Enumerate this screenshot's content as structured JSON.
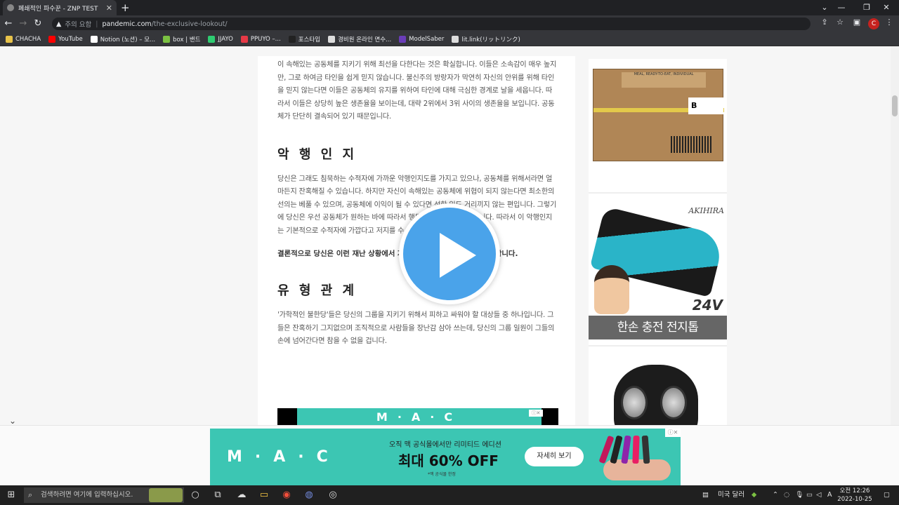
{
  "browser": {
    "tab_title": "폐쇄적인 파수꾼 - ZNP TEST",
    "new_tab": "+",
    "url_warning": "주의 요함",
    "url_host": "pandemic.com",
    "url_path": "/the-exclusive-lookout/",
    "bookmarks": [
      {
        "label": "CHACHA",
        "color": "#e8c34a"
      },
      {
        "label": "YouTube",
        "color": "#ff0000"
      },
      {
        "label": "Notion (노션) – 모...",
        "color": "#ffffff"
      },
      {
        "label": "box | 밴드",
        "color": "#7bc142"
      },
      {
        "label": "JJAYO",
        "color": "#2ecc71"
      },
      {
        "label": "PPUYO –...",
        "color": "#e63946"
      },
      {
        "label": "포스타입",
        "color": "#222222"
      },
      {
        "label": "경비원 온라인 면수...",
        "color": "#dddddd"
      },
      {
        "label": "ModelSaber",
        "color": "#6a3db8"
      },
      {
        "label": "lit.link(リットリンク)",
        "color": "#dddddd"
      }
    ]
  },
  "article": {
    "para1": "이 속해있는 공동체를 지키기 위해 최선을 다한다는 것은 확실합니다. 이들은 소속감이 매우 높지만, 그로 하여금 타인을 쉽게 믿지 않습니다. 불신주의 방랑자가 막연히 자신의 안위를 위해 타인을 믿지 않는다면 이들은 공동체의 유지를 위하여 타인에 대해 극심한 경계로 날을 세웁니다. 따라서 이들은 상당히 높은 생존율을 보이는데, 대략 2위에서 3위 사이의 생존율을 보입니다. 공동체가 단단히 결속되어 있기 때문입니다.",
    "heading1": "악 행 인 지",
    "para2": "당신은 그래도 침묵하는 수적자에 가까운 악행인지도를 가지고 있으나, 공동체를 위해서라면 얼마든지 잔혹해질 수 있습니다. 하지만 자신이 속해있는 공동체에 위협이 되지 않는다면 최소한의 선의는 베풀 수 있으며, 공동체에 이익이 될 수 있다면 선한 일도 거리끼지 않는 편입니다. 그렇기에 당신은 우선 공동체가 원하는 바에 따라서 행동하고, 옳다고 생각합니다. 따라서 이 악행인지는 기본적으로 수적자에 가깝다고 저지를 수 있습니다.",
    "bold": "결론적으로 당신은 이런 재난 상황에서 자신의 공동체를 위해 무엇이든 합니다.",
    "heading2": "유 형 관 계",
    "para3": "'가학적인 불한당'들은 당신의 그룹을 지키기 위해서 피하고 싸워야 할 대상들 중 하나입니다. 그들은 잔혹하기 그지없으며 조직적으로 사람들을 장난감 삼아 쓰는데, 당신의 그룹 일원이 그들의 손에 넘어간다면 참을 수 없을 겁니다.",
    "inline_ad_logo": "M·A·C"
  },
  "sidebar_ads": {
    "box_letter": "B",
    "box_label": "MEAL, READY-TO-EAT, INDIVIDUAL",
    "brand": "AKIHIRA",
    "voltage": "24V",
    "tool_caption": "한손 충전 전지톱"
  },
  "bottom_ad": {
    "logo": "M·A·C",
    "line1": "오직 맥 공식몰에서만 리미티드 에디션",
    "line2": "최대 60% OFF",
    "line3": "*맥 공식몰 한정",
    "cta": "자세히 보기",
    "ad_marker": "ⓘ✕",
    "lipstick_colors": [
      "#c2185b",
      "#222222",
      "#8e24aa",
      "#e91e63",
      "#333333"
    ]
  },
  "taskbar": {
    "search_placeholder": "검색하려면 여기에 입력하십시오.",
    "weather": "미국 달러",
    "time": "오전 12:26",
    "date": "2022-10-25"
  }
}
